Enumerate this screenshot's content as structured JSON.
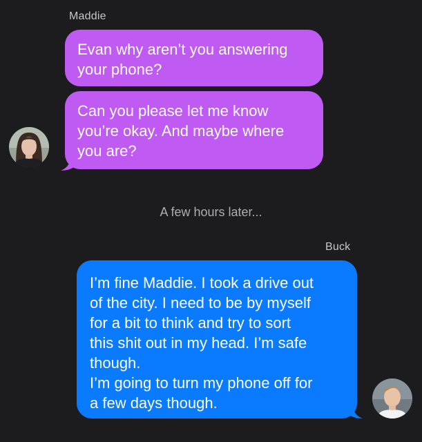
{
  "conversation": {
    "messages": [
      {
        "sender": "Maddie",
        "direction": "incoming",
        "bubbles": [
          "Evan why aren’t you answering\nyour phone?",
          "Can you please let me know\nyou’re okay. And maybe where\nyou are?"
        ],
        "avatar": "maddie-avatar"
      },
      {
        "sender": "Buck",
        "direction": "outgoing",
        "bubbles": [
          "I’m fine Maddie. I took a drive out\nof the city. I need to be by myself\nfor a bit to think and try to sort\nthis shit out in my head. I’m safe\nthough.\nI’m going to turn my phone off for\na few days though."
        ],
        "avatar": "buck-avatar"
      }
    ],
    "time_divider": "A few hours later..."
  },
  "colors": {
    "background": "#1c1c1e",
    "incoming_bubble": "#bf5af2",
    "outgoing_bubble": "#0a7bff",
    "sender_name": "#c7c7cc",
    "timestamp": "#aeaeb2"
  }
}
